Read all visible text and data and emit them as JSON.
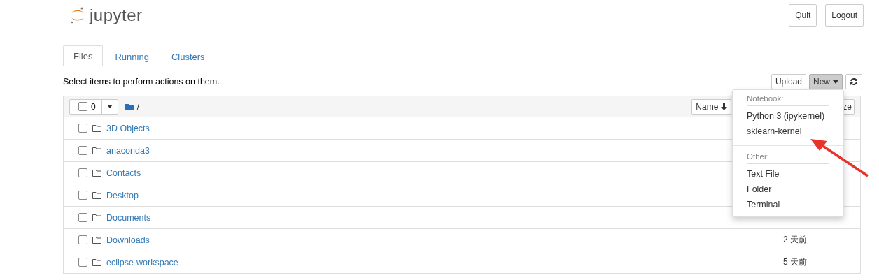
{
  "header": {
    "logo_text": "jupyter",
    "buttons": [
      "Quit",
      "Logout"
    ]
  },
  "tabs": [
    {
      "label": "Files",
      "selected": true
    },
    {
      "label": "Running",
      "selected": false
    },
    {
      "label": "Clusters",
      "selected": false
    }
  ],
  "toolbar": {
    "hint": "Select items to perform actions on them.",
    "upload": "Upload",
    "new": "New",
    "new_open": true
  },
  "list_header": {
    "selected_count": "0",
    "path": "/",
    "sort_button": "Name",
    "size_button": "ze"
  },
  "rows": [
    {
      "name": "3D Objects",
      "checked": false
    },
    {
      "name": "anaconda3",
      "checked": false
    },
    {
      "name": "Contacts",
      "checked": false
    },
    {
      "name": "Desktop",
      "checked": false
    },
    {
      "name": "Documents",
      "checked": false
    },
    {
      "name": "Downloads",
      "modified": "2 天前",
      "checked": false
    },
    {
      "name": "eclipse-workspace",
      "modified": "5 天前",
      "checked": false
    }
  ],
  "new_menu": [
    {
      "kind": "header",
      "label": "Notebook:"
    },
    {
      "kind": "item",
      "label": "Python 3 (ipykernel)"
    },
    {
      "kind": "item",
      "label": "sklearn-kernel"
    },
    {
      "kind": "divider"
    },
    {
      "kind": "header",
      "label": "Other:"
    },
    {
      "kind": "item",
      "label": "Text File"
    },
    {
      "kind": "item",
      "label": "Folder"
    },
    {
      "kind": "item",
      "label": "Terminal"
    }
  ]
}
